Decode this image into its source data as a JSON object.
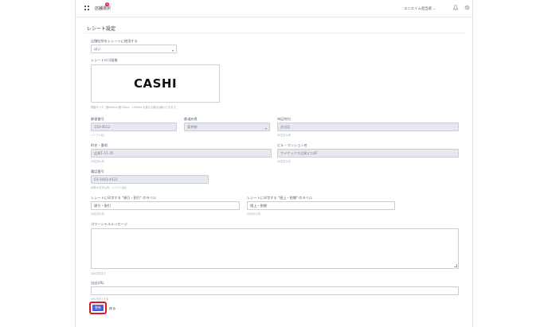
{
  "topbar": {
    "store_label": "店舗選択",
    "badge": "1",
    "company": "エニエイム",
    "user": "担当者 ⌄"
  },
  "page": {
    "title": "レシート設定"
  },
  "receipt_logo_toggle": {
    "label": "店舗住所をレシートに使用する",
    "value": "はい"
  },
  "receipt_logo": {
    "label": "レシートロゴ画像",
    "logo_text": "CASHI",
    "hint": "推奨サイズ：横600px×縦150px。1,000px を超える場合は縮小されます。"
  },
  "postal_code": {
    "label": "郵便番号",
    "value": "150-0012",
    "hint": "ハイフンなし"
  },
  "prefecture": {
    "label": "都道府県",
    "value": "東京都"
  },
  "city": {
    "label": "市区町村",
    "value": "渋谷区",
    "hint": "20文字以内"
  },
  "street": {
    "label": "町名・番地",
    "value": "広尾1-11-35",
    "hint": "20文字以内"
  },
  "building": {
    "label": "ビル・マンション名",
    "value": "ワイケックス広尾ビル6F",
    "hint": "20文字以内"
  },
  "phone": {
    "label": "電話番号",
    "value": "03-3443-4422",
    "hint": "半角15文字以内・ハイフン含む"
  },
  "receipt_label_1": {
    "label": "レシートに印字する \"値引・割引\" のラベル",
    "value": "値引・割引",
    "hint": "20文字以内"
  },
  "receipt_label_2": {
    "label": "レシートに印字する \"値上・割増\" のラベル",
    "value": "値上・割増",
    "hint": "20文字以内"
  },
  "commercial_message": {
    "label": "コマーシャルメッセージ",
    "value": "",
    "hint": "200文字まで"
  },
  "coupon_url": {
    "label": "自店URL",
    "value": "",
    "hint": "URLを記入する"
  },
  "actions": {
    "update_label": "更新",
    "back_label": "戻る"
  },
  "colors": {
    "primary": "#4f5bd5",
    "highlight_border": "#e0171f",
    "badge": "#e0245e"
  }
}
